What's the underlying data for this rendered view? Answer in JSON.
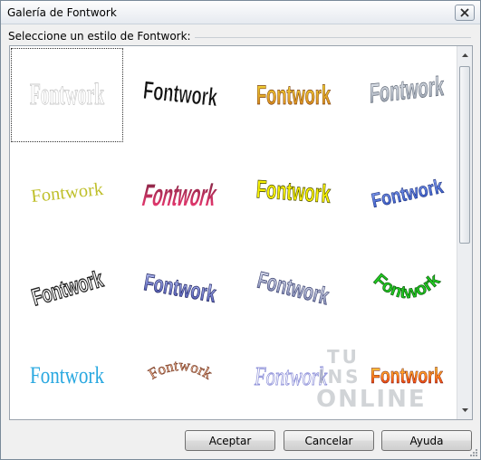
{
  "window": {
    "title": "Galería de Fontwork"
  },
  "prompt_label": "Seleccione un estilo de Fontwork:",
  "styles": [
    {
      "label": "Fontwork"
    },
    {
      "label": "Fontwork"
    },
    {
      "label": "Fontwork"
    },
    {
      "label": "Fontwork"
    },
    {
      "label": "Fontwork"
    },
    {
      "label": "Fontwork"
    },
    {
      "label": "Fontwork"
    },
    {
      "label": "Fontwork"
    },
    {
      "label": "Fontwork"
    },
    {
      "label": "Fontwork"
    },
    {
      "label": "Fontwork"
    },
    {
      "label": "Fontwork"
    },
    {
      "label": "Fontwork"
    },
    {
      "label": "Fontwork"
    },
    {
      "label": "Fontwork"
    },
    {
      "label": "Fontwork"
    }
  ],
  "buttons": {
    "ok": "Aceptar",
    "cancel": "Cancelar",
    "help": "Ayuda"
  },
  "watermark": {
    "line1": "TU",
    "line2": "INS",
    "line3": "ONLINE"
  },
  "colors": {
    "accent_yellow": "#f2d21a",
    "accent_red": "#e2306c",
    "accent_blue": "#3b5fc9",
    "accent_green": "#22cc22"
  }
}
